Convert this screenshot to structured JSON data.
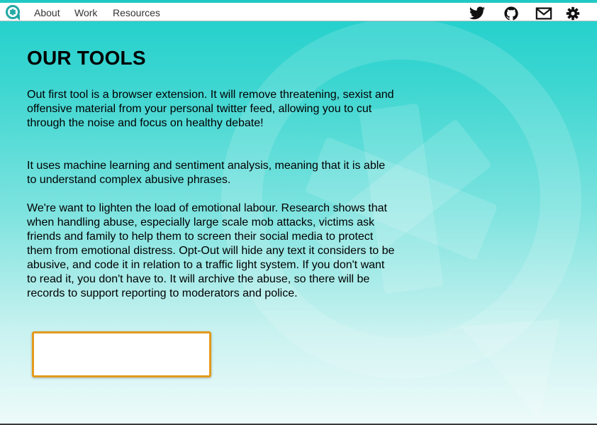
{
  "nav": {
    "links": [
      "About",
      "Work",
      "Resources"
    ],
    "icons": [
      "twitter-icon",
      "github-icon",
      "mail-icon",
      "gear-icon"
    ],
    "accent_color": "#22c9c4"
  },
  "main": {
    "title": "OUR TOOLS",
    "paragraphs": [
      "Out first tool is a browser extension. It will remove threatening, sexist and offensive material from your personal twitter feed, allowing you to cut through the noise and focus on healthy debate!",
      "It uses machine learning and sentiment analysis, meaning that it is able to understand complex abusive phrases.",
      "We're want to lighten the load of emotional labour. Research shows that when handling abuse, especially large scale mob attacks, victims ask friends and family to help them to screen their social media to protect them from emotional distress. Opt-Out will hide any text it considers to be abusive, and code it in relation to a traffic light system. If you don't want to read it, you don't have to. It will archive the abuse, so there will be records to support reporting to moderators and police."
    ],
    "cta_border_color": "#e39a1c"
  }
}
